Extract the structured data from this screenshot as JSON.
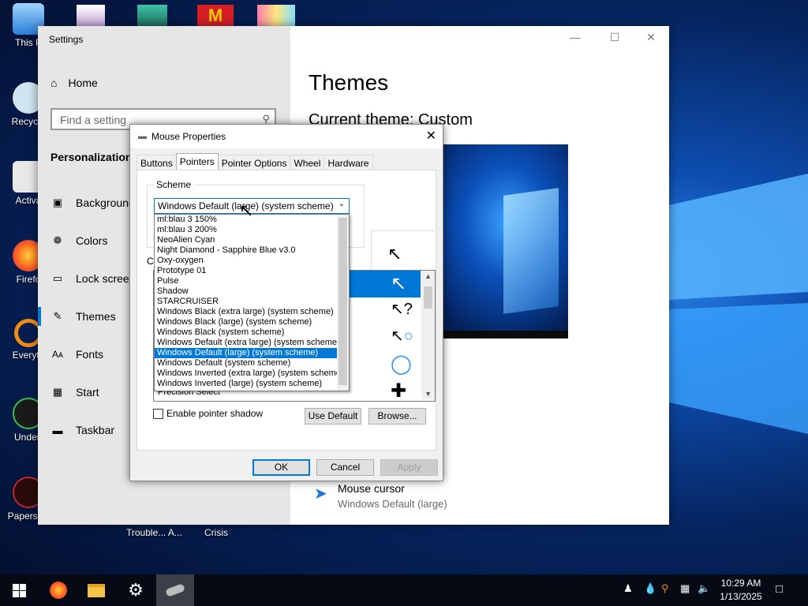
{
  "desktop": {
    "icons": [
      {
        "label": "This P",
        "icon": "computer-icon"
      },
      {
        "label": "Recycle",
        "icon": "recycle-bin-icon"
      },
      {
        "label": "Activa",
        "icon": "document-icon"
      },
      {
        "label": "Firefo",
        "icon": "firefox-icon"
      },
      {
        "label": "Everyth",
        "icon": "search-app-icon"
      },
      {
        "label": "Undert",
        "icon": "game-icon"
      },
      {
        "label": "Papers, P",
        "icon": "game-icon"
      }
    ],
    "bottom_labels": [
      "Trouble... A...",
      "Crisis"
    ]
  },
  "settings": {
    "title": "Settings",
    "home": "Home",
    "search_placeholder": "Find a setting",
    "section": "Personalization",
    "nav": [
      {
        "label": "Background",
        "icon": "image-icon"
      },
      {
        "label": "Colors",
        "icon": "palette-icon"
      },
      {
        "label": "Lock screen",
        "icon": "lock-screen-icon"
      },
      {
        "label": "Themes",
        "icon": "themes-icon",
        "selected": true
      },
      {
        "label": "Fonts",
        "icon": "fonts-icon"
      },
      {
        "label": "Start",
        "icon": "start-icon"
      },
      {
        "label": "Taskbar",
        "icon": "taskbar-icon"
      }
    ],
    "page_title": "Themes",
    "current_theme": "Current theme: Custom",
    "mouse_cursor_title": "Mouse cursor",
    "mouse_cursor_value": "Windows Default (large)"
  },
  "mouse_properties": {
    "title": "Mouse Properties",
    "tabs": [
      "Buttons",
      "Pointers",
      "Pointer Options",
      "Wheel",
      "Hardware"
    ],
    "active_tab": "Pointers",
    "scheme_label": "Scheme",
    "scheme_selected": "Windows Default (large) (system scheme)",
    "customize_label": "Cu",
    "scheme_options": [
      "ml:blau 3 150%",
      "ml:blau 3 200%",
      "NeoAlien Cyan",
      "Night Diamond - Sapphire Blue v3.0",
      "Oxy-oxygen",
      "Prototype 01",
      "Pulse",
      "Shadow",
      "STARCRUISER",
      "Windows Black (extra large) (system scheme)",
      "Windows Black (large) (system scheme)",
      "Windows Black (system scheme)",
      "Windows Default (extra large) (system scheme)",
      "Windows Default (large) (system scheme)",
      "Windows Default (system scheme)",
      "Windows Inverted (extra large) (system scheme)",
      "Windows Inverted (large) (system scheme)"
    ],
    "selected_option_index": 13,
    "precision_select": "Precision Select",
    "enable_shadow": "Enable pointer shadow",
    "use_default": "Use Default",
    "browse": "Browse...",
    "ok": "OK",
    "cancel": "Cancel",
    "apply": "Apply"
  },
  "taskbar": {
    "apps": [
      "start-icon",
      "firefox-icon",
      "file-explorer-icon",
      "settings-gear-icon",
      "mouse-properties-icon"
    ],
    "time": "10:29 AM",
    "date": "1/13/2025"
  },
  "colors": {
    "accent": "#0078d7"
  }
}
